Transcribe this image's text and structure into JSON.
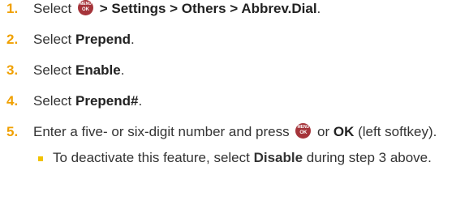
{
  "steps": [
    {
      "number": "1.",
      "before": "Select ",
      "path": " > Settings > Others > Abbrev.Dial",
      "after": "."
    },
    {
      "number": "2.",
      "before": "Select ",
      "bold": "Prepend",
      "after": "."
    },
    {
      "number": "3.",
      "before": "Select ",
      "bold": "Enable",
      "after": "."
    },
    {
      "number": "4.",
      "before": "Select ",
      "bold": "Prepend#",
      "after": "."
    },
    {
      "number": "5.",
      "before": "Enter a five- or six-digit number and press ",
      "middle": " or ",
      "bold": "OK",
      "after": " (left softkey).",
      "sub": {
        "before": "To deactivate this feature, select ",
        "bold": "Disable",
        "after": " during step 3 above."
      }
    }
  ],
  "menu_key": {
    "top_label": "MENU",
    "bottom_label": "OK",
    "color": "#a5343a"
  },
  "colors": {
    "step_number": "#f0a000",
    "bullet": "#f2c200",
    "text": "#333333"
  }
}
